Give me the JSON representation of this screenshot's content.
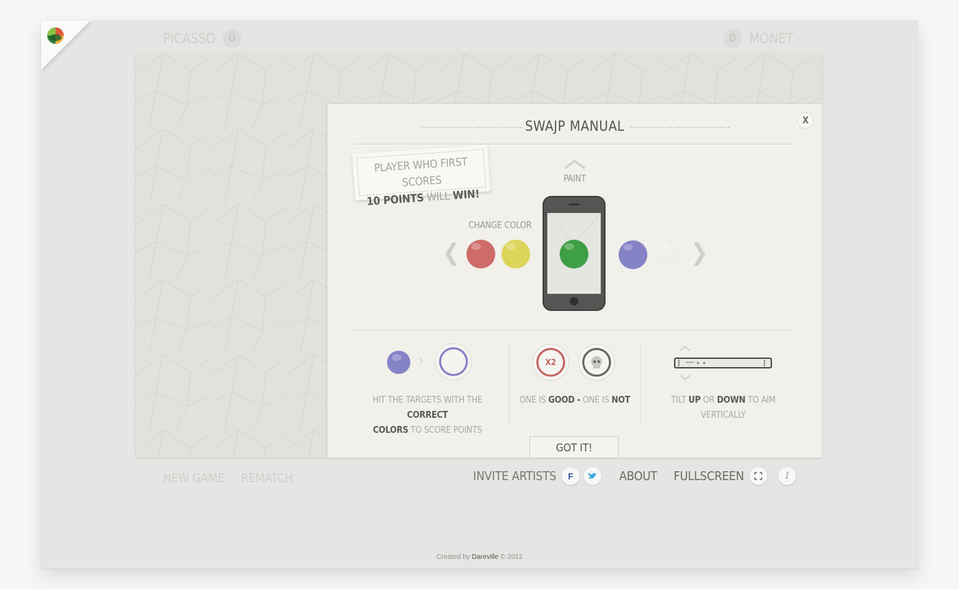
{
  "players": {
    "left": {
      "name": "Picasso",
      "score": "0"
    },
    "right": {
      "name": "Monet",
      "score": "0"
    }
  },
  "modal": {
    "title": "Swajp Manual",
    "close_label": "X",
    "note": {
      "line1": "Player who first scores",
      "points": "10 points",
      "will": "will",
      "win": "win!"
    },
    "paint_label": "Paint",
    "change_color_label": "Change color",
    "colors": {
      "red": "#cf6b69",
      "yellow": "#dcd55a",
      "green": "#3f9f45",
      "purple": "#8582c6",
      "white": "#efefec",
      "target_gray": "#666664"
    },
    "sections": [
      {
        "pre": "Hit the targets with the",
        "b1": "correct",
        "b2": "colors",
        "post": "to score points"
      },
      {
        "a": "One is",
        "b1": "good",
        "dash": "-",
        "c": "one is",
        "b2": "not",
        "x2_label": "X2"
      },
      {
        "a": "Tilt",
        "b1": "up",
        "c": "or",
        "b2": "down",
        "d": "to aim vertically"
      }
    ],
    "got_it": "Got it!"
  },
  "nav": {
    "new_game": "New game",
    "rematch": "Rematch",
    "invite": "Invite artists",
    "about": "About",
    "fullscreen": "Fullscreen"
  },
  "credit": {
    "pre": "Created by",
    "name": "Dareville",
    "post": "© 2012"
  }
}
